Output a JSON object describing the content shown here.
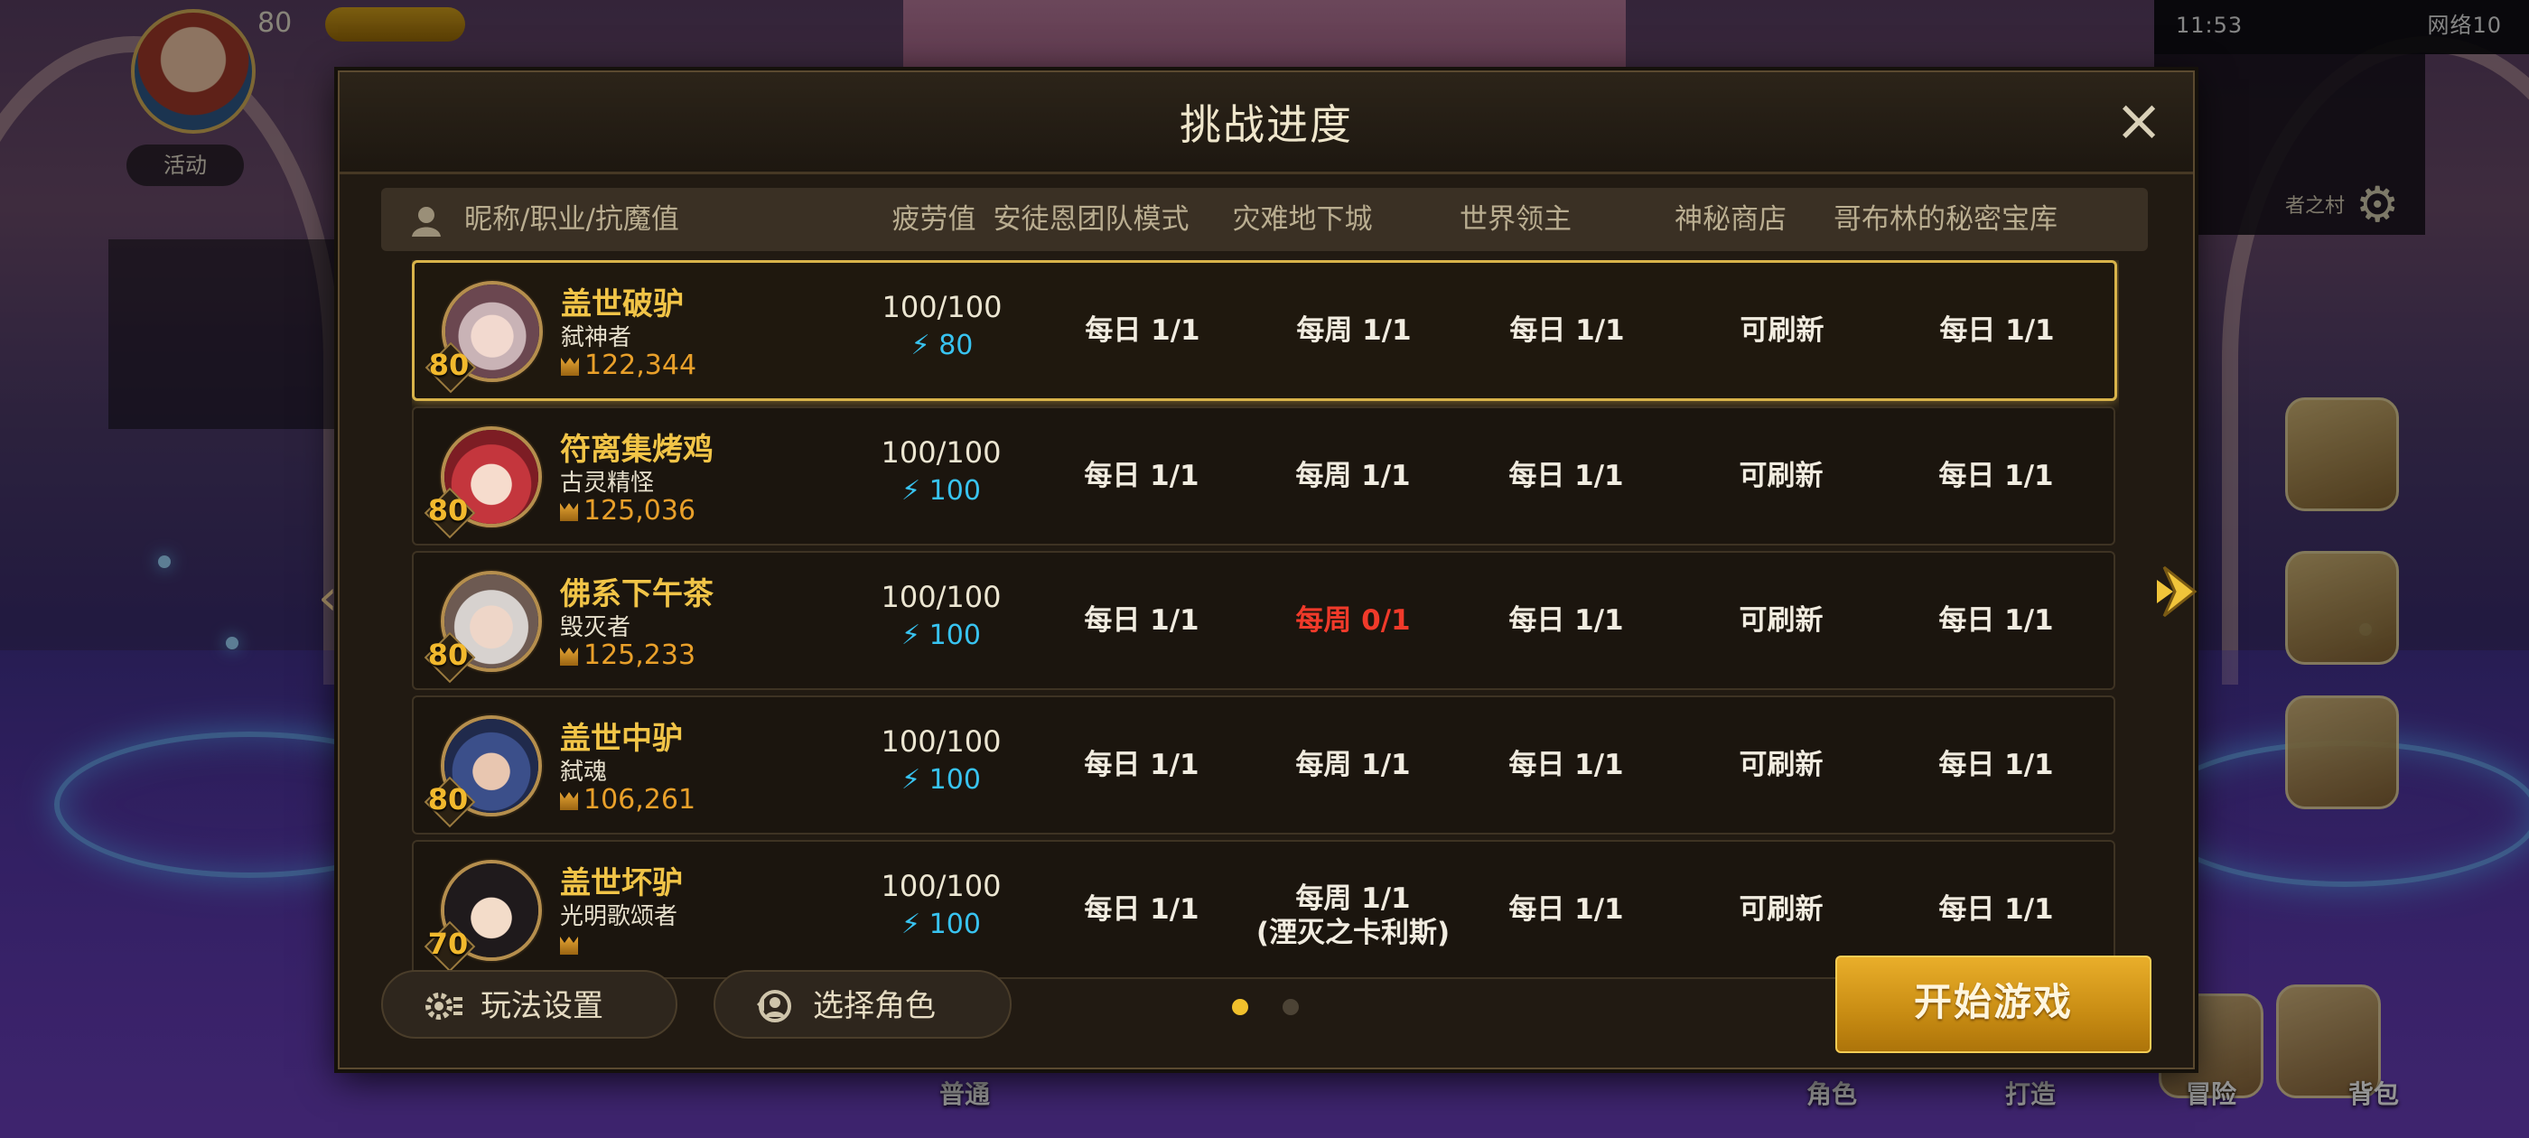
{
  "hud": {
    "level": "80",
    "btn_label": "活动",
    "status_time": "11:53",
    "status_right": "网络10",
    "minimap_label": "者之村",
    "bottom_labels": [
      "普通",
      "角色",
      "打造",
      "冒险",
      "背包"
    ]
  },
  "modal": {
    "title": "挑战进度",
    "close_icon": "close-icon",
    "columns": {
      "name": "昵称/职业/抗魔值",
      "fatigue": "疲劳值",
      "raid": "安徒恩团队模式",
      "calamity": "灾难地下城",
      "world_boss": "世界领主",
      "mystic_shop": "神秘商店",
      "goblin_vault": "哥布林的秘密宝库"
    },
    "characters": [
      {
        "name": "盖世破驴",
        "class": "弑神者",
        "level": "80",
        "power": "122,344",
        "fatigue": "100/100",
        "stamina": "80",
        "raid": "每日 1/1",
        "calamity": "每周 1/1",
        "calamity_note": "",
        "world_boss": "每日 1/1",
        "mystic_shop": "可刷新",
        "goblin_vault": "每日 1/1"
      },
      {
        "name": "符离集烤鸡",
        "class": "古灵精怪",
        "level": "80",
        "power": "125,036",
        "fatigue": "100/100",
        "stamina": "100",
        "raid": "每日 1/1",
        "calamity": "每周 1/1",
        "calamity_note": "",
        "world_boss": "每日 1/1",
        "mystic_shop": "可刷新",
        "goblin_vault": "每日 1/1"
      },
      {
        "name": "佛系下午茶",
        "class": "毁灭者",
        "level": "80",
        "power": "125,233",
        "fatigue": "100/100",
        "stamina": "100",
        "raid": "每日 1/1",
        "calamity": "每周 0/1",
        "calamity_note": "",
        "world_boss": "每日 1/1",
        "mystic_shop": "可刷新",
        "goblin_vault": "每日 1/1"
      },
      {
        "name": "盖世中驴",
        "class": "弑魂",
        "level": "80",
        "power": "106,261",
        "fatigue": "100/100",
        "stamina": "100",
        "raid": "每日 1/1",
        "calamity": "每周 1/1",
        "calamity_note": "",
        "world_boss": "每日 1/1",
        "mystic_shop": "可刷新",
        "goblin_vault": "每日 1/1"
      },
      {
        "name": "盖世坏驴",
        "class": "光明歌颂者",
        "level": "70",
        "power": "",
        "fatigue": "100/100",
        "stamina": "100",
        "raid": "每日 1/1",
        "calamity": "每周 1/1",
        "calamity_note": "(湮灭之卡利斯)",
        "world_boss": "每日 1/1",
        "mystic_shop": "可刷新",
        "goblin_vault": "每日 1/1"
      }
    ],
    "footer": {
      "settings_label": "玩法设置",
      "select_label": "选择角色",
      "start_label": "开始游戏",
      "page_dots": {
        "count": 2,
        "active": 1
      }
    },
    "colors": {
      "accent_gold": "#f1c447",
      "stamina_blue": "#38c3f0",
      "warning_red": "#f03a2a",
      "start_button": "#e9ae2a"
    }
  }
}
